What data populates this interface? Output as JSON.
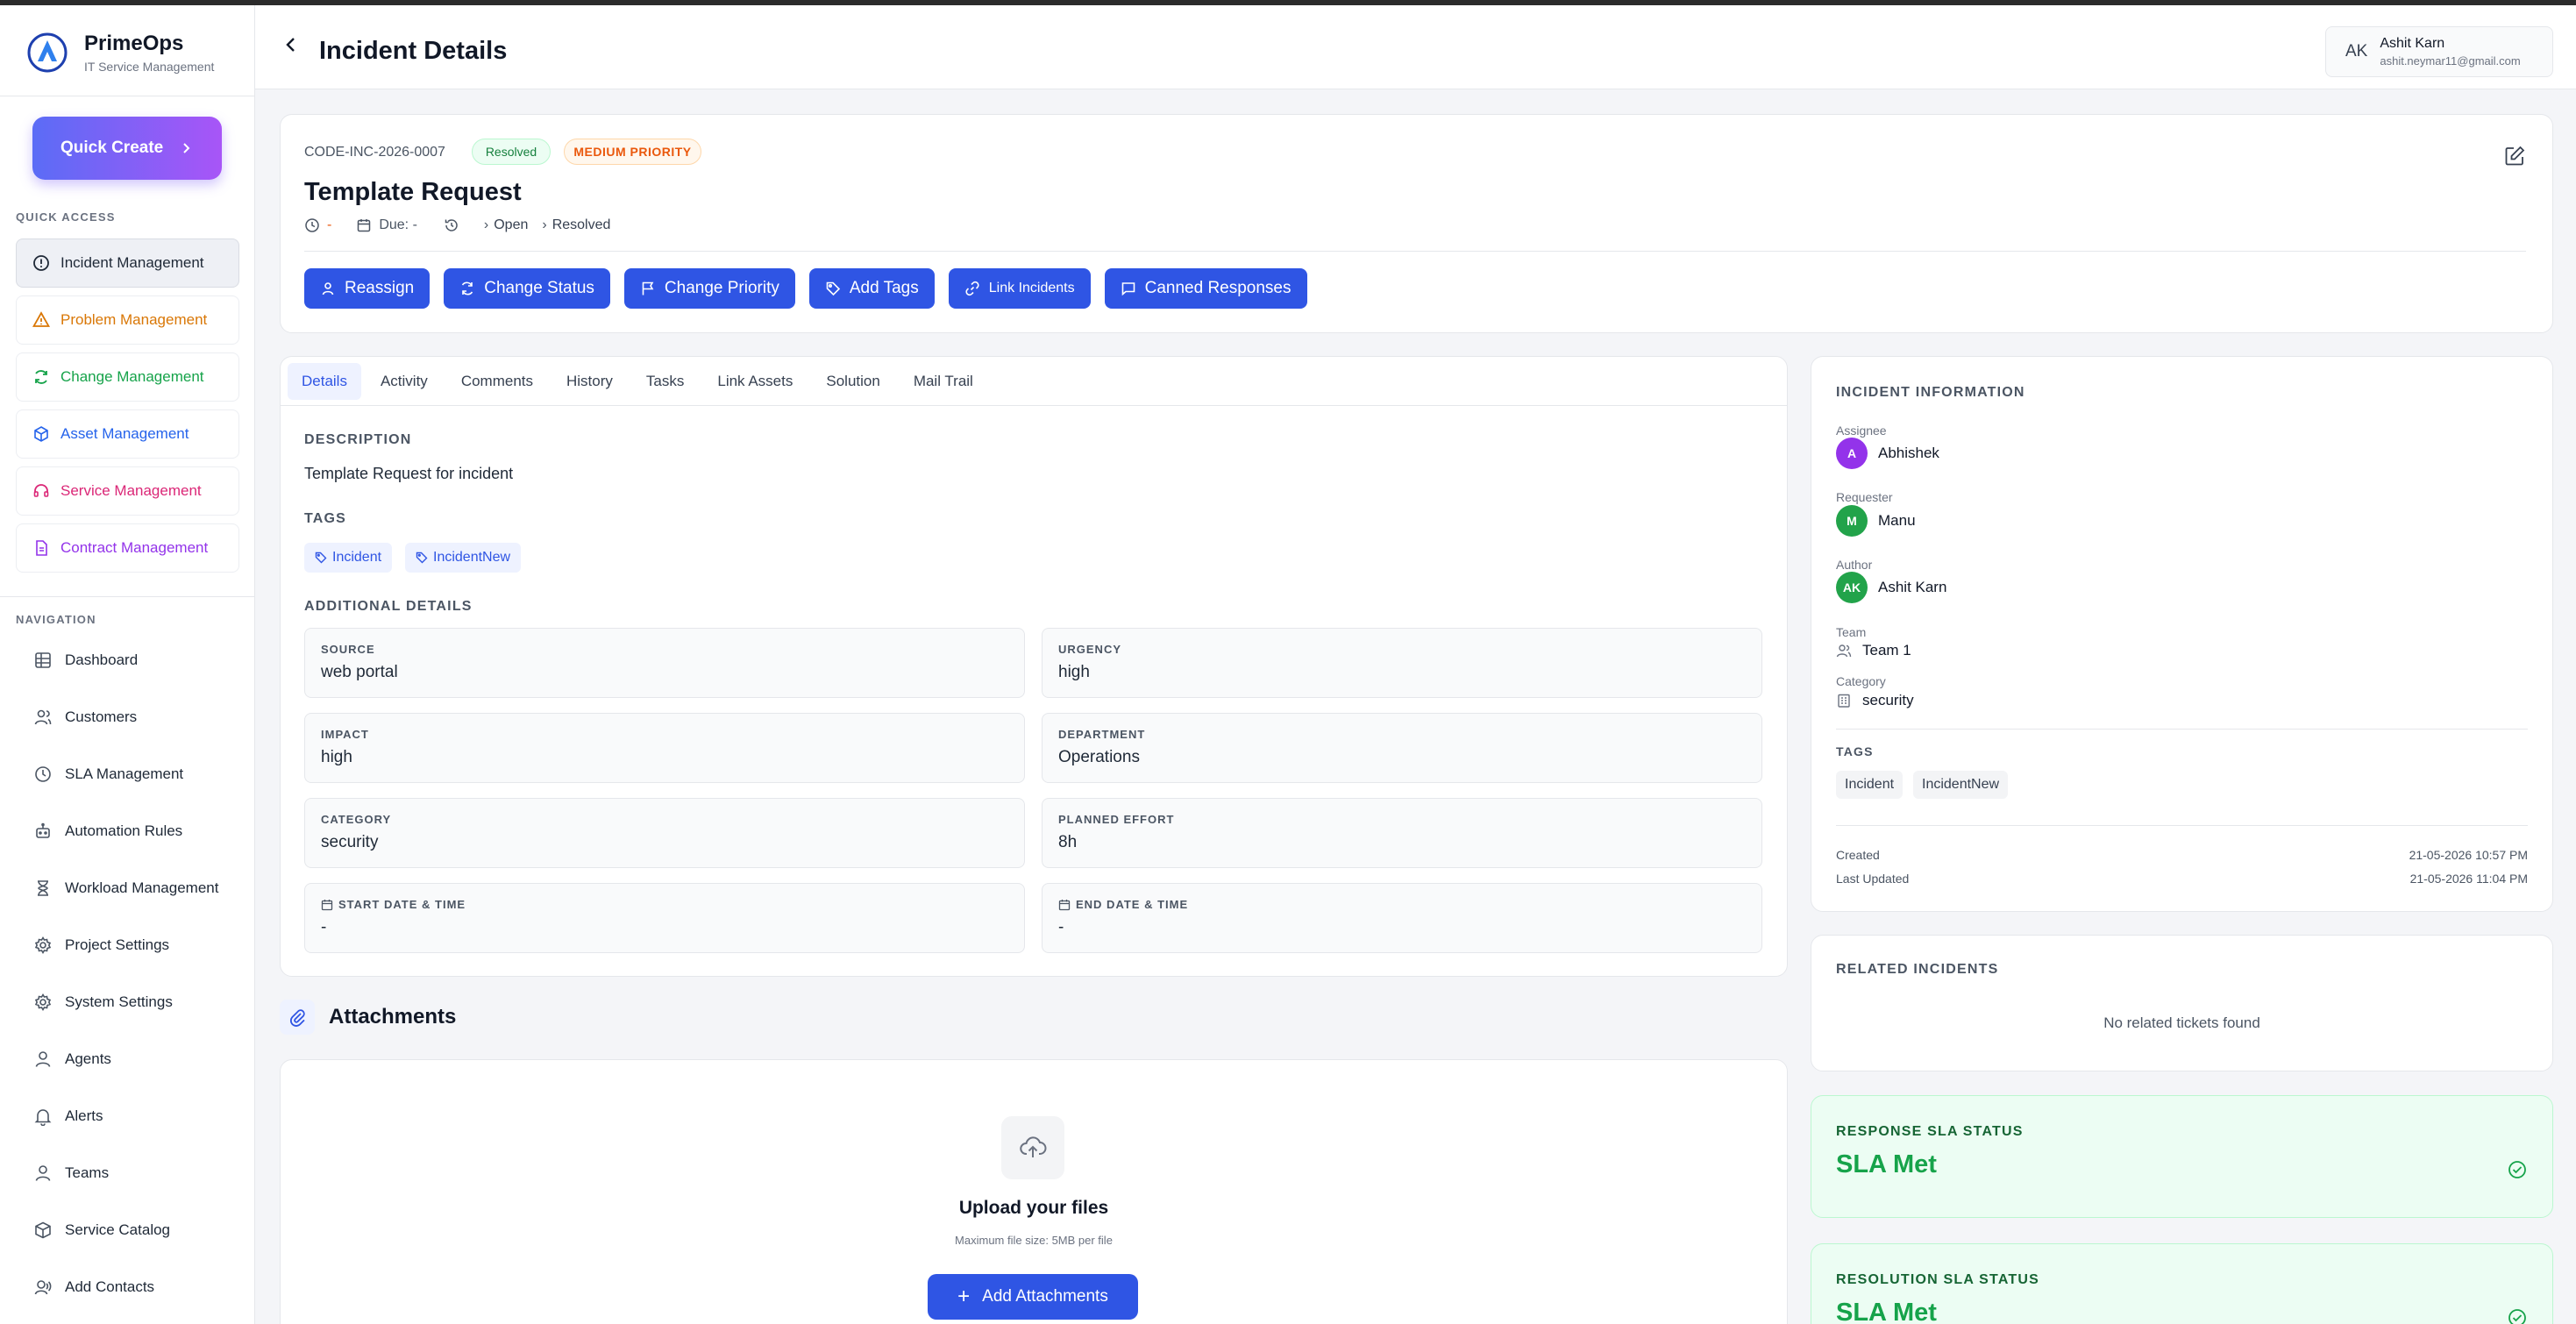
{
  "app": {
    "name": "PrimeOps",
    "subtitle": "IT Service Management",
    "quick_create_label": "Quick Create"
  },
  "sidebar": {
    "quick_access_label": "QUICK ACCESS",
    "quick_access": [
      {
        "label": "Incident Management",
        "icon": "alert-circle-icon",
        "color": "#1f2937",
        "active": true
      },
      {
        "label": "Problem Management",
        "icon": "warning-triangle-icon",
        "color": "#d97706"
      },
      {
        "label": "Change Management",
        "icon": "refresh-icon",
        "color": "#16a34a"
      },
      {
        "label": "Asset Management",
        "icon": "cube-icon",
        "color": "#2563eb"
      },
      {
        "label": "Service Management",
        "icon": "headset-icon",
        "color": "#db2777"
      },
      {
        "label": "Contract Management",
        "icon": "document-icon",
        "color": "#9333ea"
      }
    ],
    "navigation_label": "NAVIGATION",
    "navigation": [
      {
        "label": "Dashboard",
        "icon": "grid-icon"
      },
      {
        "label": "Customers",
        "icon": "users-icon"
      },
      {
        "label": "SLA Management",
        "icon": "clock-icon"
      },
      {
        "label": "Automation Rules",
        "icon": "robot-icon"
      },
      {
        "label": "Workload Management",
        "icon": "hourglass-icon"
      },
      {
        "label": "Project Settings",
        "icon": "gear-icon"
      },
      {
        "label": "System Settings",
        "icon": "gear-icon"
      },
      {
        "label": "Agents",
        "icon": "user-icon"
      },
      {
        "label": "Alerts",
        "icon": "bell-icon"
      },
      {
        "label": "Teams",
        "icon": "team-icon"
      },
      {
        "label": "Service Catalog",
        "icon": "box-icon"
      },
      {
        "label": "Add Contacts",
        "icon": "contact-icon"
      }
    ]
  },
  "header": {
    "title": "Incident Details",
    "user": {
      "initials": "AK",
      "name": "Ashit Karn",
      "email": "ashit.neymar11@gmail.com"
    }
  },
  "incident": {
    "code": "CODE-INC-2026-0007",
    "status_badge": "Resolved",
    "priority_badge": "MEDIUM PRIORITY",
    "title": "Template Request",
    "time_value": "-",
    "due_label": "Due: -",
    "status_from": "Open",
    "status_to": "Resolved",
    "actions": {
      "reassign": "Reassign",
      "change_status": "Change Status",
      "change_priority": "Change Priority",
      "add_tags": "Add Tags",
      "link_incidents": "Link Incidents",
      "canned_responses": "Canned Responses"
    }
  },
  "tabs": [
    "Details",
    "Activity",
    "Comments",
    "History",
    "Tasks",
    "Link Assets",
    "Solution",
    "Mail Trail"
  ],
  "details": {
    "description_label": "DESCRIPTION",
    "description": "Template Request for incident",
    "tags_label": "TAGS",
    "tags": [
      "Incident",
      "IncidentNew"
    ],
    "additional_label": "ADDITIONAL DETAILS",
    "fields": {
      "source": {
        "label": "SOURCE",
        "value": "web portal"
      },
      "urgency": {
        "label": "URGENCY",
        "value": "high"
      },
      "impact": {
        "label": "IMPACT",
        "value": "high"
      },
      "department": {
        "label": "DEPARTMENT",
        "value": "Operations"
      },
      "category": {
        "label": "CATEGORY",
        "value": "security"
      },
      "planned_effort": {
        "label": "PLANNED EFFORT",
        "value": "8h"
      },
      "start": {
        "label": "START DATE & TIME",
        "value": "-"
      },
      "end": {
        "label": "END DATE & TIME",
        "value": "-"
      }
    }
  },
  "attachments": {
    "title": "Attachments",
    "upload_title": "Upload your files",
    "upload_sub": "Maximum file size: 5MB per file",
    "add_button": "Add Attachments"
  },
  "info": {
    "title": "INCIDENT INFORMATION",
    "assignee_label": "Assignee",
    "assignee": {
      "initials": "A",
      "name": "Abhishek",
      "color": "#9333ea"
    },
    "requester_label": "Requester",
    "requester": {
      "initials": "M",
      "name": "Manu",
      "color": "#22a34a"
    },
    "author_label": "Author",
    "author": {
      "initials": "AK",
      "name": "Ashit Karn",
      "color": "#22a34a"
    },
    "team_label": "Team",
    "team": "Team 1",
    "category_label": "Category",
    "category": "security",
    "tags_label": "TAGS",
    "tags": [
      "Incident",
      "IncidentNew"
    ],
    "created_label": "Created",
    "created": "21-05-2026 10:57 PM",
    "updated_label": "Last Updated",
    "updated": "21-05-2026 11:04 PM"
  },
  "related": {
    "title": "RELATED INCIDENTS",
    "empty": "No related tickets found"
  },
  "sla": {
    "response_label": "RESPONSE SLA STATUS",
    "response_value": "SLA Met",
    "resolution_label": "RESOLUTION SLA STATUS",
    "resolution_value": "SLA Met"
  }
}
